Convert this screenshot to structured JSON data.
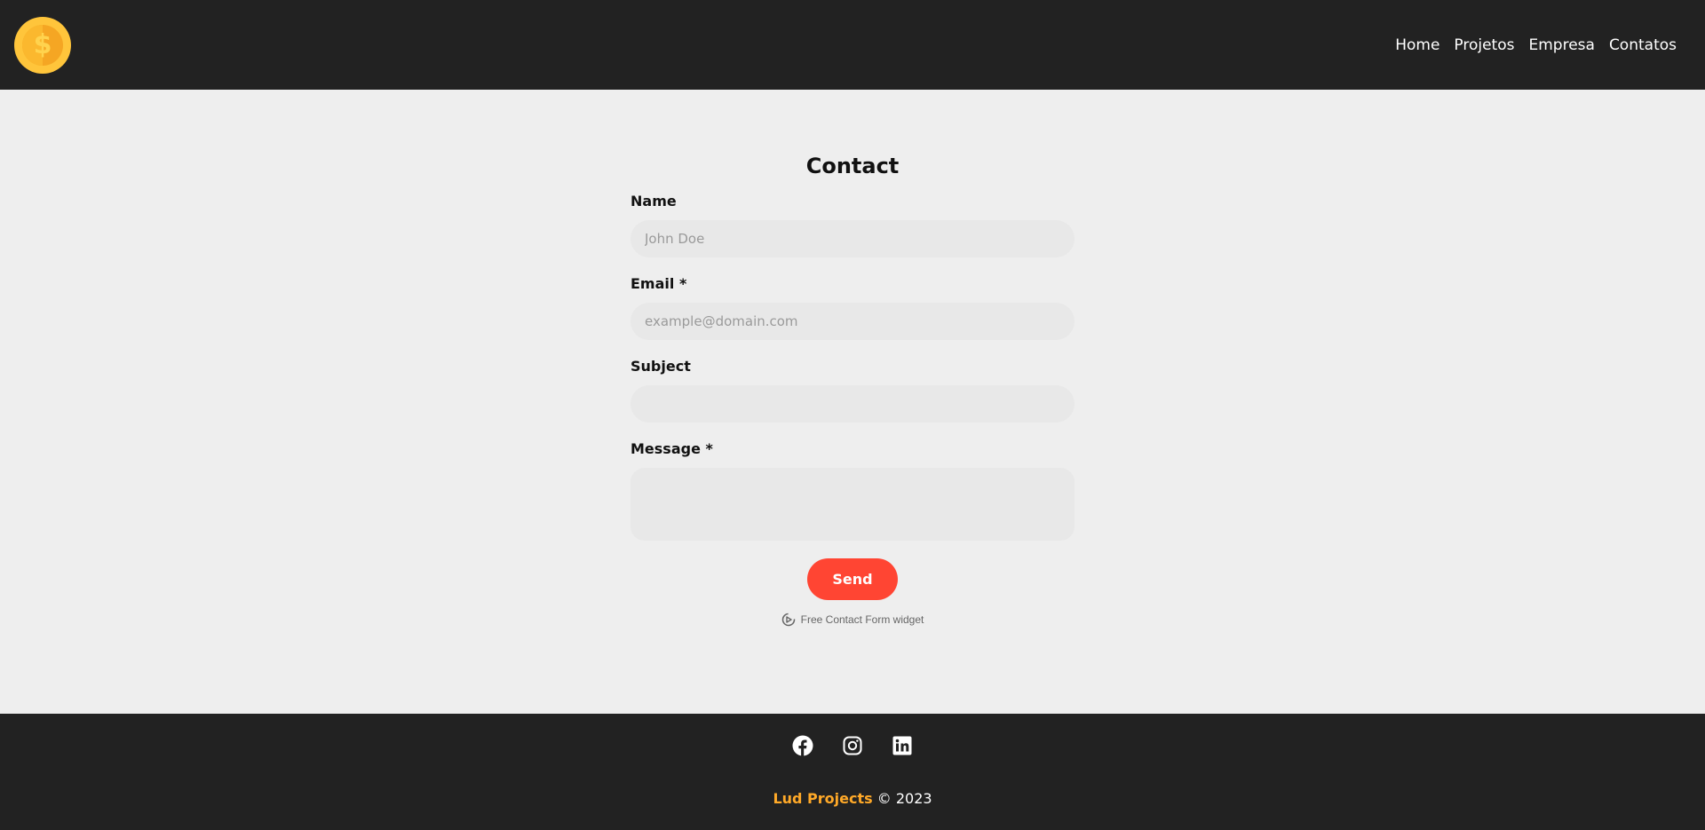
{
  "header": {
    "logo_icon": "dollar-coin-icon",
    "logo_symbol": "$",
    "nav": [
      {
        "label": "Home"
      },
      {
        "label": "Projetos"
      },
      {
        "label": "Empresa"
      },
      {
        "label": "Contatos"
      }
    ]
  },
  "form": {
    "title": "Contact",
    "fields": {
      "name": {
        "label": "Name",
        "placeholder": "John Doe",
        "value": ""
      },
      "email": {
        "label": "Email *",
        "placeholder": "example@domain.com",
        "value": ""
      },
      "subject": {
        "label": "Subject",
        "placeholder": "",
        "value": ""
      },
      "message": {
        "label": "Message *",
        "placeholder": "",
        "value": ""
      }
    },
    "send_label": "Send",
    "widget_text": "Free Contact Form widget"
  },
  "footer": {
    "socials": [
      {
        "icon": "facebook-icon"
      },
      {
        "icon": "instagram-icon"
      },
      {
        "icon": "linkedin-icon"
      }
    ],
    "brand": "Lud Projects",
    "copyright": "© 2023"
  },
  "colors": {
    "header_bg": "#222222",
    "page_bg": "#eeeeee",
    "accent_button": "#ff4533",
    "brand": "#ffa928",
    "coin": "#ffc53b"
  }
}
